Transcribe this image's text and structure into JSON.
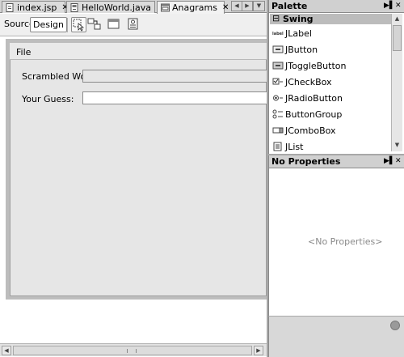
{
  "editor": {
    "tabs": [
      {
        "label": "index.jsp",
        "icon": "jsp-file-icon"
      },
      {
        "label": "HelloWorld.java",
        "icon": "java-file-icon"
      },
      {
        "label": "Anagrams",
        "icon": "form-file-icon"
      }
    ],
    "close_glyph": "✕"
  },
  "toolbar": {
    "source_label": "Source",
    "design_label": "Design",
    "icons": [
      "selection-mode-icon",
      "connection-mode-icon",
      "preview-design-icon",
      "test-form-icon"
    ]
  },
  "form": {
    "menu_label": "File",
    "scrambled_label": "Scrambled Word:",
    "guess_label": "Your Guess:",
    "scrambled_value": "",
    "guess_value": ""
  },
  "palette": {
    "title": "Palette",
    "category": "Swing",
    "category_toggle": "⊟",
    "items": [
      {
        "label": "JLabel",
        "icon": "jlabel-icon"
      },
      {
        "label": "JButton",
        "icon": "jbutton-icon"
      },
      {
        "label": "JToggleButton",
        "icon": "jtogglebutton-icon"
      },
      {
        "label": "JCheckBox",
        "icon": "jcheckbox-icon"
      },
      {
        "label": "JRadioButton",
        "icon": "jradiobutton-icon"
      },
      {
        "label": "ButtonGroup",
        "icon": "buttongroup-icon"
      },
      {
        "label": "JComboBox",
        "icon": "jcombobox-icon"
      },
      {
        "label": "JList",
        "icon": "jlist-icon"
      }
    ]
  },
  "properties": {
    "title": "No Properties",
    "empty_text": "<No Properties>"
  },
  "colors": {
    "header_bg": "#d0d0d0",
    "form_bg": "#e6e6e6",
    "frame_bg": "#bdbdbd"
  }
}
